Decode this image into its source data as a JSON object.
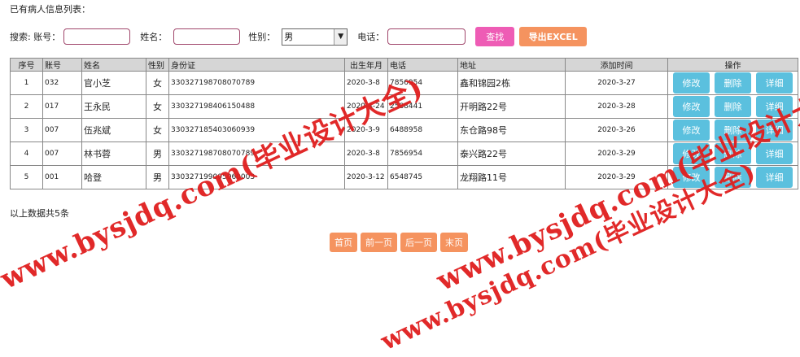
{
  "heading": "已有病人信息列表：",
  "search": {
    "prefix": "搜索: 账号：",
    "account_value": "",
    "name_label": "姓名：",
    "name_value": "",
    "gender_label": "性别：",
    "gender_value": "男",
    "phone_label": "电话：",
    "phone_value": "",
    "search_button": "查找",
    "export_button": "导出EXCEL"
  },
  "table": {
    "headers": [
      "序号",
      "账号",
      "姓名",
      "性别",
      "身份证",
      "出生年月",
      "电话",
      "地址",
      "添加时间",
      "操作"
    ],
    "rows": [
      {
        "no": "1",
        "account": "032",
        "name": "官小芝",
        "gender": "女",
        "id": "330327198708070789",
        "birth": "2020-3-8",
        "phone": "7856954",
        "address": "鑫和锦园2栋",
        "added": "2020-3-27"
      },
      {
        "no": "2",
        "account": "017",
        "name": "王永民",
        "gender": "女",
        "id": "330327198406150488",
        "birth": "2020-4-24",
        "phone": "2588441",
        "address": "开明路22号",
        "added": "2020-3-28"
      },
      {
        "no": "3",
        "account": "007",
        "name": "伍兆斌",
        "gender": "女",
        "id": "330327185403060939",
        "birth": "2020-3-9",
        "phone": "6488958",
        "address": "东仓路98号",
        "added": "2020-3-26"
      },
      {
        "no": "4",
        "account": "007",
        "name": "林书蓉",
        "gender": "男",
        "id": "330327198708070789",
        "birth": "2020-3-8",
        "phone": "7856954",
        "address": "泰兴路22号",
        "added": "2020-3-29"
      },
      {
        "no": "5",
        "account": "001",
        "name": "哈登",
        "gender": "男",
        "id": "330327199005060003",
        "birth": "2020-3-12",
        "phone": "6548745",
        "address": "龙翔路11号",
        "added": "2020-3-29"
      }
    ],
    "actions": {
      "edit": "修改",
      "delete": "删除",
      "detail": "详细"
    }
  },
  "summary": "以上数据共5条",
  "pager": {
    "first": "首页",
    "prev": "前一页",
    "next": "后一页",
    "last": "末页"
  },
  "watermark": "www.bysjdq.com(毕业设计大全)",
  "colors": {
    "search_btn": "#ee5cb5",
    "export_btn": "#f5935f",
    "op_btn": "#5bc0de",
    "watermark": "#e01e1e",
    "header_bg": "#d6d6d6"
  }
}
